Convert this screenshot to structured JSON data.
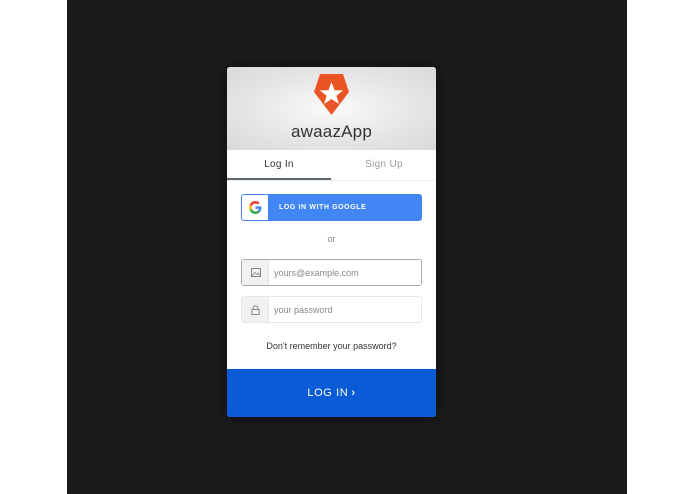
{
  "app": {
    "title": "awaazApp",
    "logo_icon": "shield-star-icon",
    "brand_color": "#eb5424"
  },
  "tabs": [
    {
      "label": "Log In",
      "active": true
    },
    {
      "label": "Sign Up",
      "active": false
    }
  ],
  "social": {
    "google_label": "LOG IN WITH GOOGLE",
    "icon": "google-icon",
    "color": "#4285f4"
  },
  "divider_text": "or",
  "form": {
    "email": {
      "value": "",
      "placeholder": "yours@example.com",
      "icon": "envelope-icon"
    },
    "password": {
      "value": "",
      "placeholder": "your password",
      "icon": "lock-icon"
    },
    "forgot_label": "Don't remember your password?",
    "submit_label": "LOG IN",
    "submit_icon": "chevron-right-icon",
    "submit_color": "#0a5bd6"
  }
}
